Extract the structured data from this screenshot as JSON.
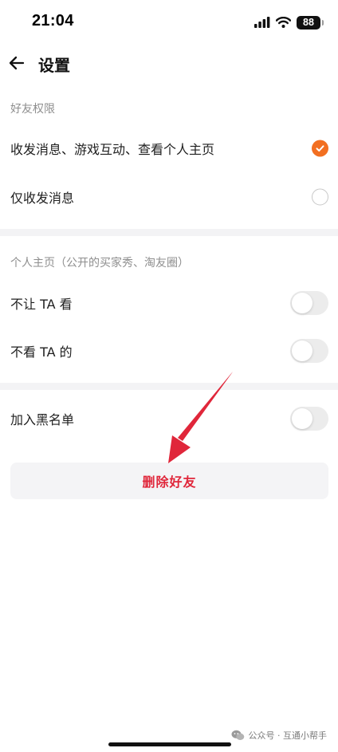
{
  "status_bar": {
    "time": "21:04",
    "battery_level": "88"
  },
  "nav": {
    "title": "设置"
  },
  "sections": {
    "friend_permissions": {
      "header": "好友权限",
      "option_full": "收发消息、游戏互动、查看个人主页",
      "option_messages_only": "仅收发消息",
      "selected": "option_full"
    },
    "profile": {
      "header": "个人主页（公开的买家秀、淘友圈）",
      "hide_from_ta": "不让 TA 看",
      "hide_from_ta_on": false,
      "dont_see_ta": "不看 TA 的",
      "dont_see_ta_on": false
    },
    "blacklist": {
      "label": "加入黑名单",
      "on": false
    }
  },
  "actions": {
    "delete_friend": "删除好友"
  },
  "colors": {
    "accent_orange": "#f26f21",
    "delete_red": "#e0263a",
    "annotation_arrow": "#e0263a"
  },
  "watermark": {
    "text": "公众号 · 互通小帮手"
  }
}
